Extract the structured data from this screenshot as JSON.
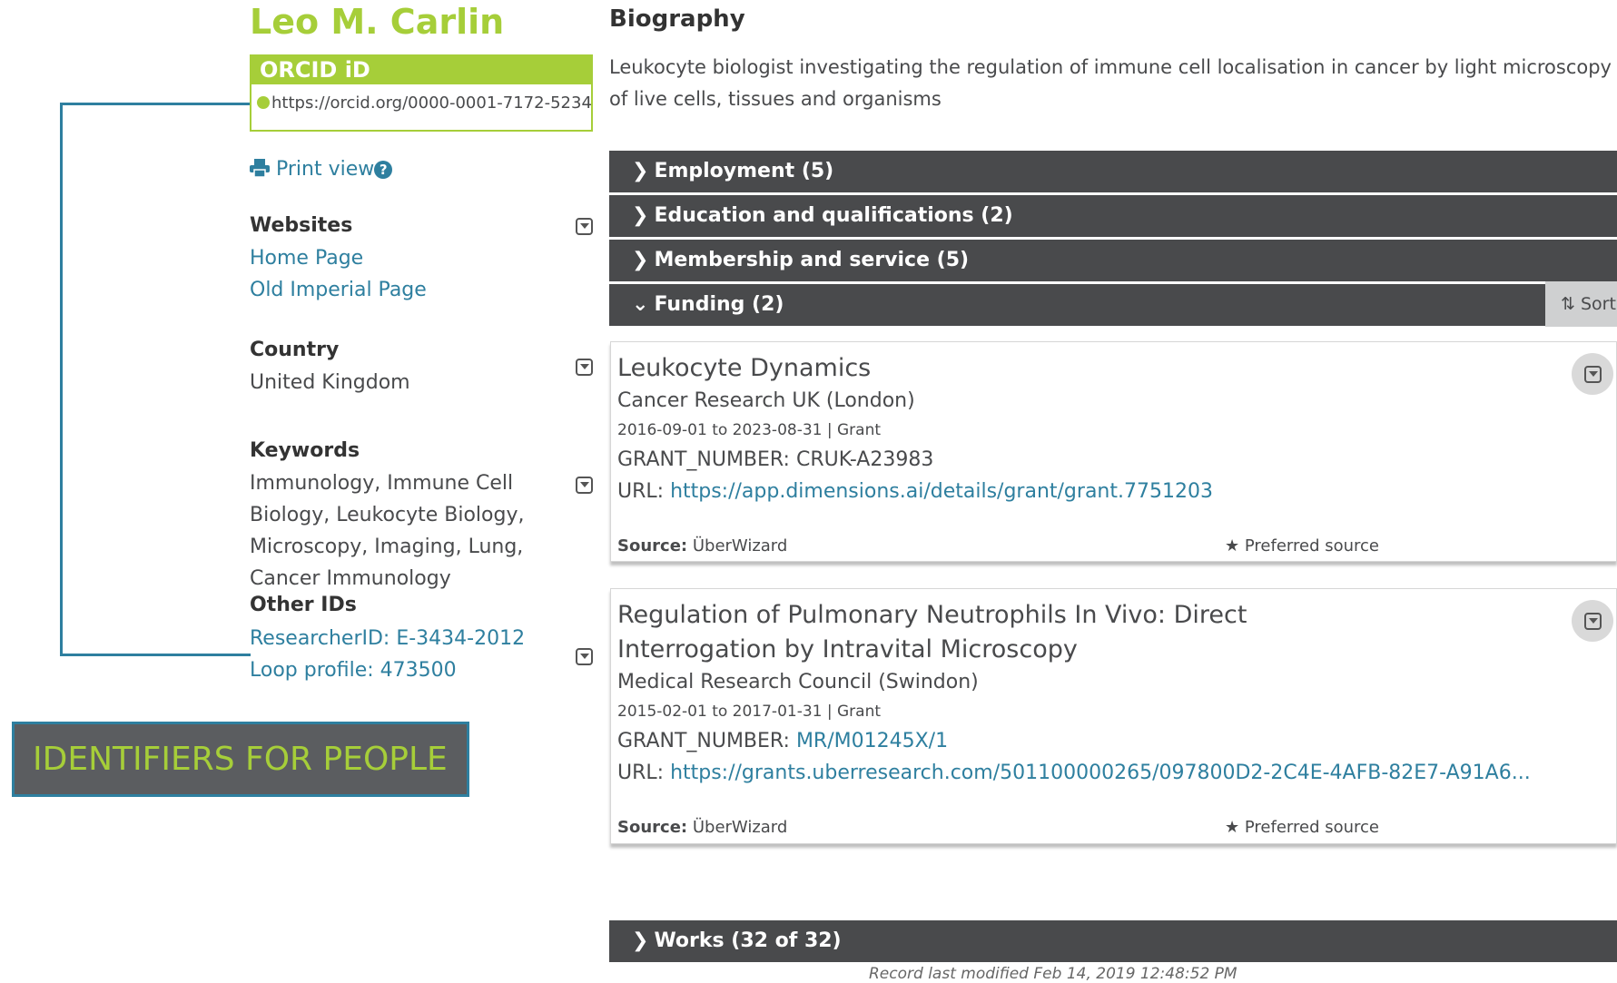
{
  "profile": {
    "name": "Leo M. Carlin",
    "orcid_label": "ORCID iD",
    "orcid_url": "https://orcid.org/0000-0001-7172-5234",
    "print_view": "Print view"
  },
  "websites": {
    "heading": "Websites",
    "items": [
      "Home Page",
      "Old Imperial Page"
    ]
  },
  "country": {
    "heading": "Country",
    "value": "United Kingdom"
  },
  "keywords": {
    "heading": "Keywords",
    "value": "Immunology, Immune Cell Biology, Leukocyte Biology, Microscopy, Imaging, Lung, Cancer Immunology"
  },
  "other_ids": {
    "heading": "Other IDs",
    "items": [
      "ResearcherID: E-3434-2012",
      "Loop profile: 473500"
    ]
  },
  "callout": {
    "text": "IDENTIFIERS FOR PEOPLE"
  },
  "biography": {
    "heading": "Biography",
    "text": "Leukocyte biologist investigating the regulation of immune cell localisation in cancer by light microscopy of live cells, tissues and organisms"
  },
  "sections": {
    "employment": "Employment (5)",
    "education": "Education and qualifications (2)",
    "membership": "Membership and service (5)",
    "funding": "Funding (2)",
    "sort": "Sort",
    "works": "Works (32 of 32)"
  },
  "funding": [
    {
      "title": "Leukocyte Dynamics",
      "org": "Cancer Research UK (London)",
      "dates": "2016-09-01 to 2023-08-31 | Grant",
      "grant_label": "GRANT_NUMBER:",
      "grant_value": "CRUK-A23983",
      "url_label": "URL:",
      "url": "https://app.dimensions.ai/details/grant/grant.7751203",
      "source_label": "Source:",
      "source": "ÜberWizard",
      "preferred": "Preferred source"
    },
    {
      "title": "Regulation of Pulmonary Neutrophils In Vivo: Direct Interrogation by Intravital Microscopy",
      "org": "Medical Research Council (Swindon)",
      "dates": "2015-02-01 to 2017-01-31 | Grant",
      "grant_label": "GRANT_NUMBER:",
      "grant_value": "MR/M01245X/1",
      "url_label": "URL:",
      "url": "https://grants.uberresearch.com/501100000265/097800D2-2C4E-4AFB-82E7-A91A6...",
      "source_label": "Source:",
      "source": "ÜberWizard",
      "preferred": "Preferred source"
    }
  ],
  "footer": {
    "modified": "Record last modified Feb 14, 2019 12:48:52 PM"
  },
  "colors": {
    "orcid_green": "#a6ce39",
    "link_blue": "#2e7f9f",
    "bar_dark": "#494a4c",
    "callout_bg": "#5b5d60"
  }
}
